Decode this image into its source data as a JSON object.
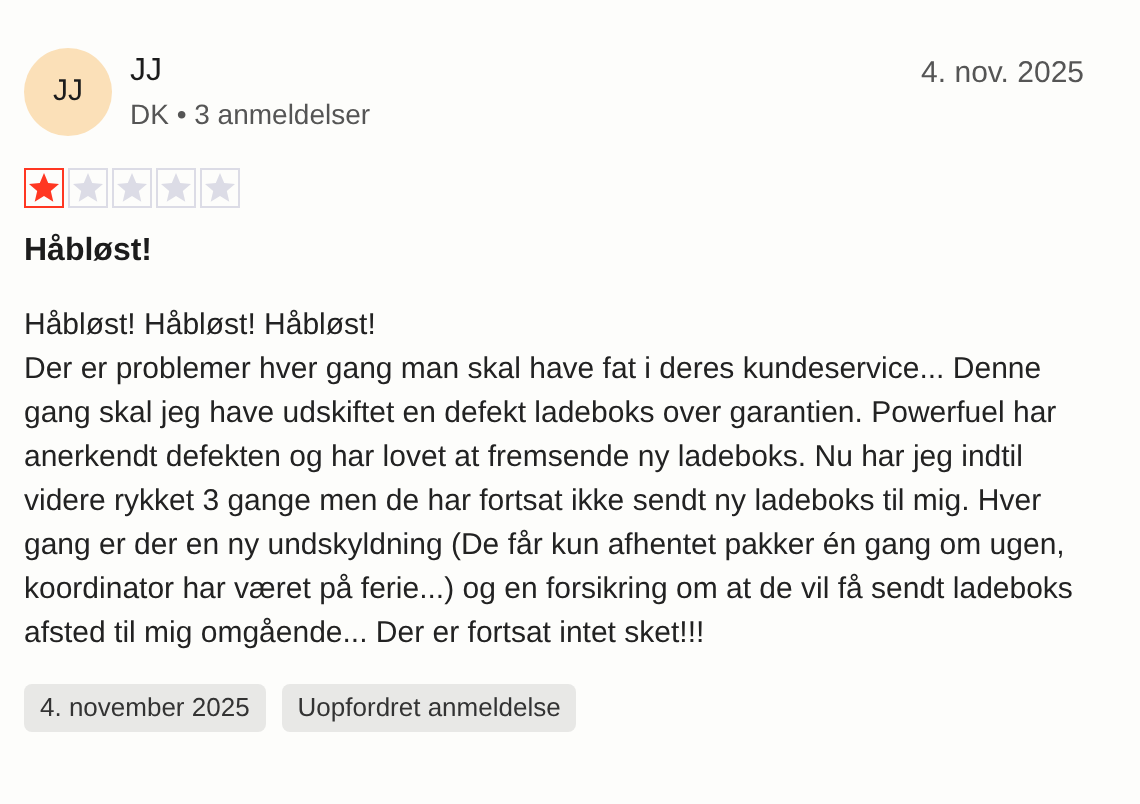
{
  "review": {
    "avatar_initials": "JJ",
    "author": "JJ",
    "meta": "DK • 3 anmeldelser",
    "date": "4. nov. 2025",
    "stars": 1,
    "title": "Håbløst!",
    "body": [
      "Håbløst! Håbløst! Håbløst!",
      "Der er problemer hver gang man skal have fat i deres kundeservice... Denne gang skal jeg have udskiftet en defekt ladeboks over garantien. Powerfuel har anerkendt defekten og har lovet at fremsende ny ladeboks. Nu har jeg indtil videre rykket 3 gange men de har fortsat ikke sendt ny ladeboks til mig. Hver gang er der en ny undskyldning (De får kun afhentet pakker én gang om ugen, koordinator har været på ferie...) og en forsikring om at de vil få sendt ladeboks afsted til mig omgående... Der er fortsat intet sket!!!"
    ],
    "tags": [
      "4. november 2025",
      "Uopfordret anmeldelse"
    ]
  }
}
